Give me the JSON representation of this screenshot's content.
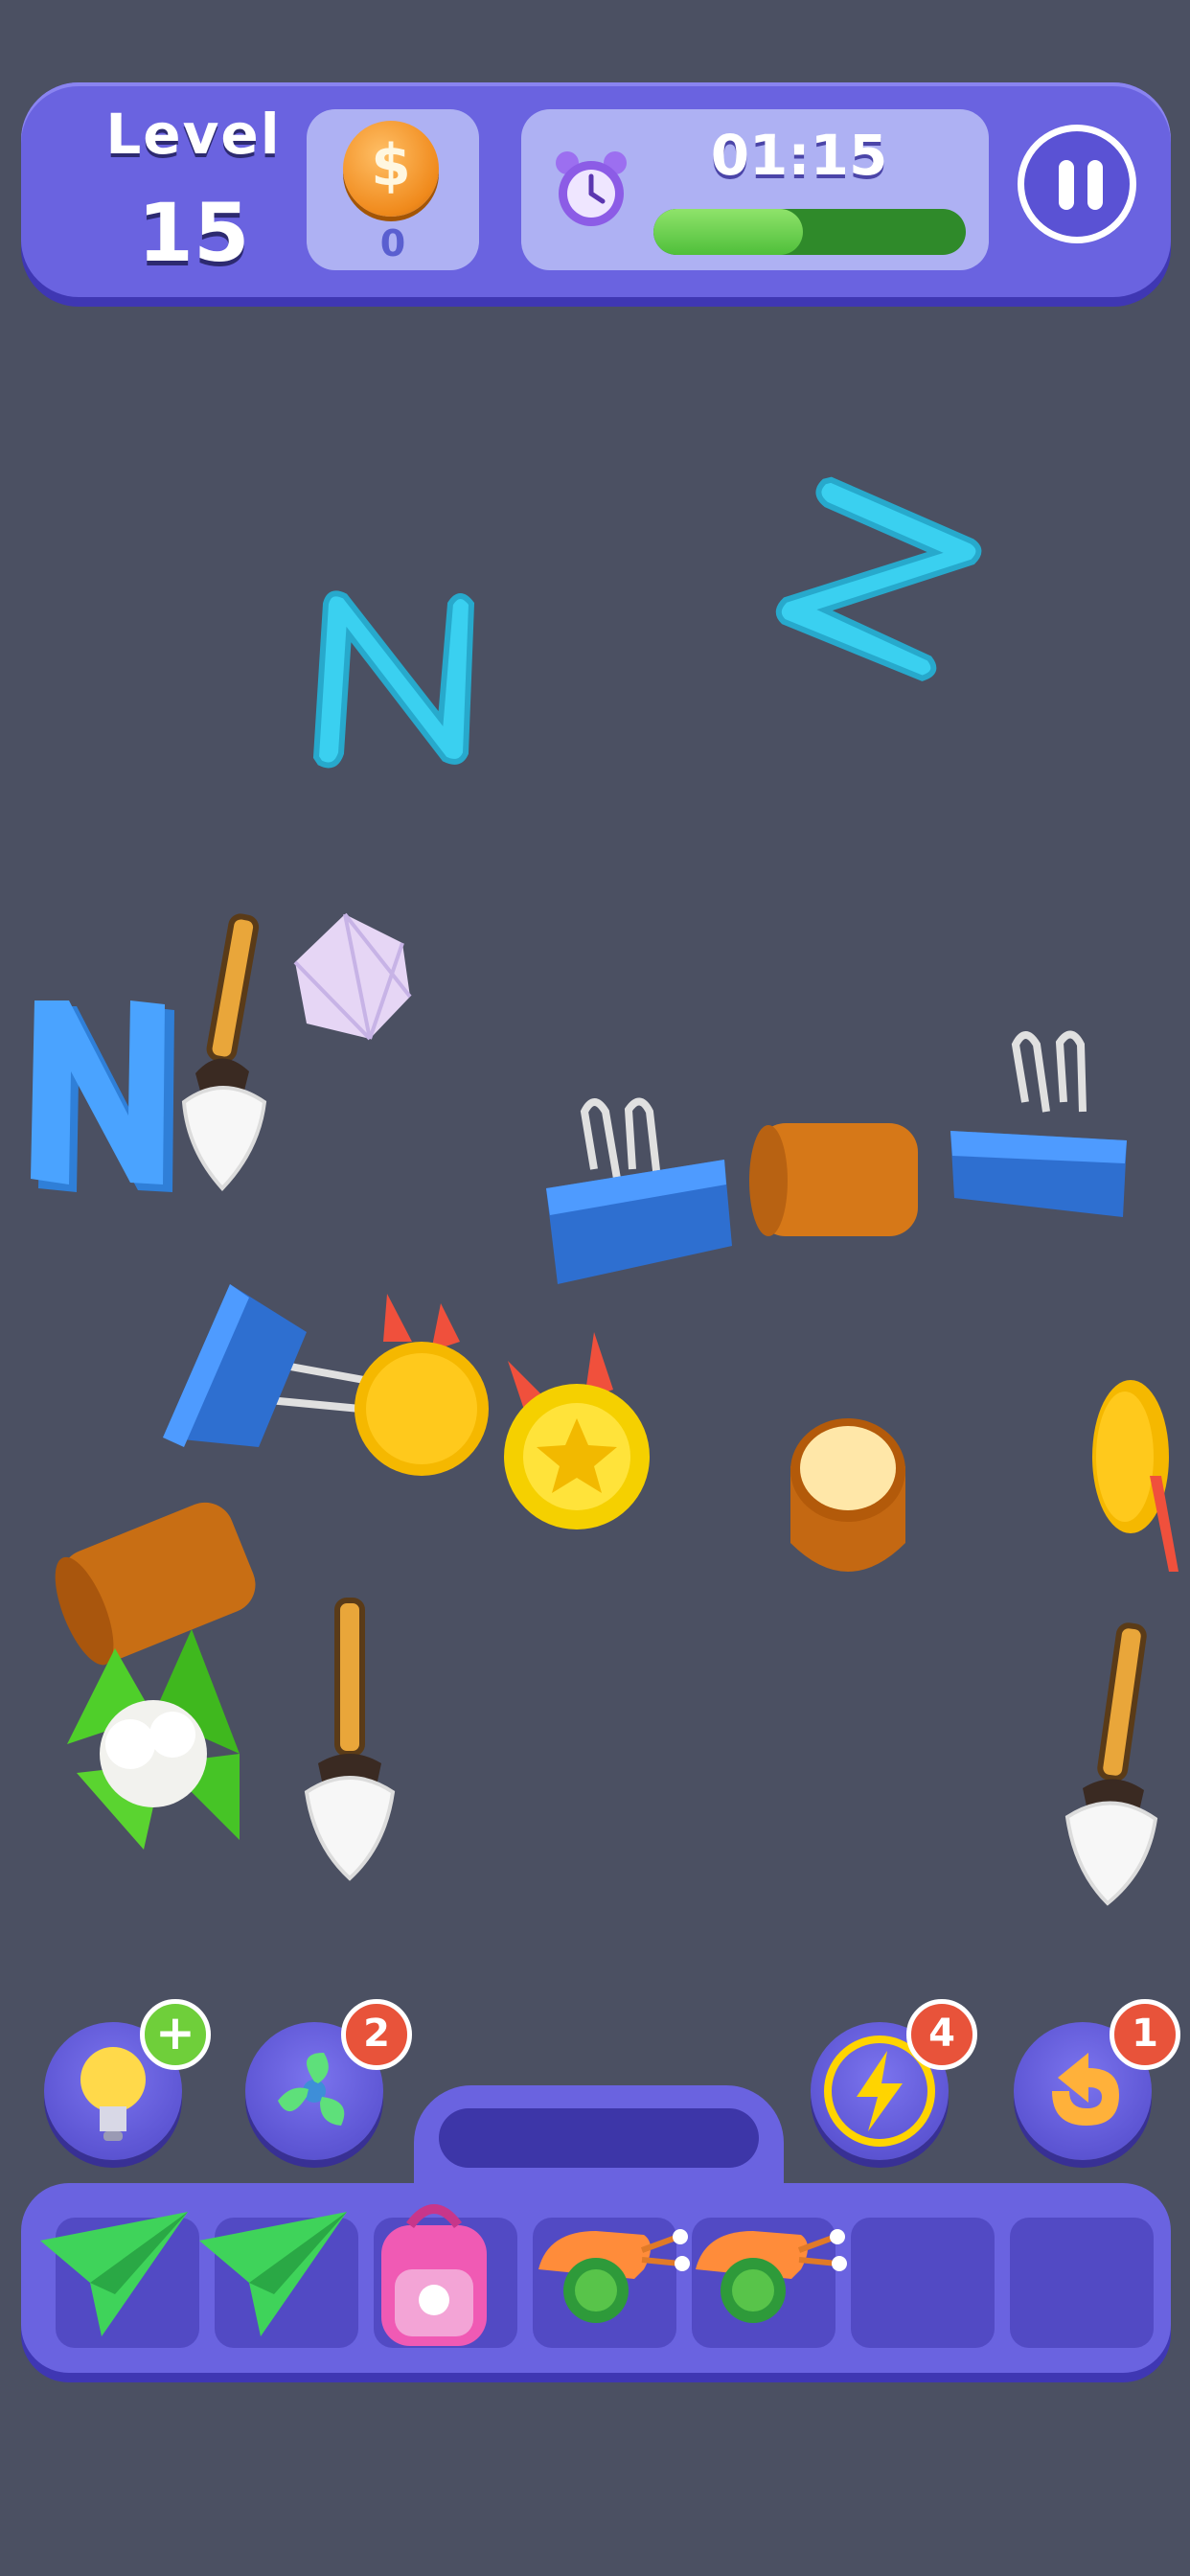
{
  "hud": {
    "level_label": "Level",
    "level_number": "15",
    "coin_symbol": "$",
    "coin_count": "0",
    "timer": "01:15",
    "time_remaining_fraction": 0.48,
    "pause_icon": "pause-icon"
  },
  "board_items": [
    "letter-n",
    "letter-n-rotated",
    "letter-n-3d",
    "paintbrush",
    "gem",
    "binder-clip",
    "wood-log",
    "gold-medal",
    "tree-stump",
    "cauliflower"
  ],
  "powerups": [
    {
      "name": "hint-bulb",
      "badge": "+"
    },
    {
      "name": "fan",
      "badge": "2"
    },
    {
      "name": "lightning",
      "badge": "4"
    },
    {
      "name": "undo",
      "badge": "1"
    }
  ],
  "tray": {
    "slots_total": 7,
    "items": [
      "paper-plane",
      "paper-plane",
      "backpack",
      "snail",
      "snail"
    ]
  },
  "colors": {
    "background": "#4b5062",
    "hud": "#6a63e0",
    "accent_green": "#4fbf3a",
    "badge_red": "#e8533a"
  }
}
